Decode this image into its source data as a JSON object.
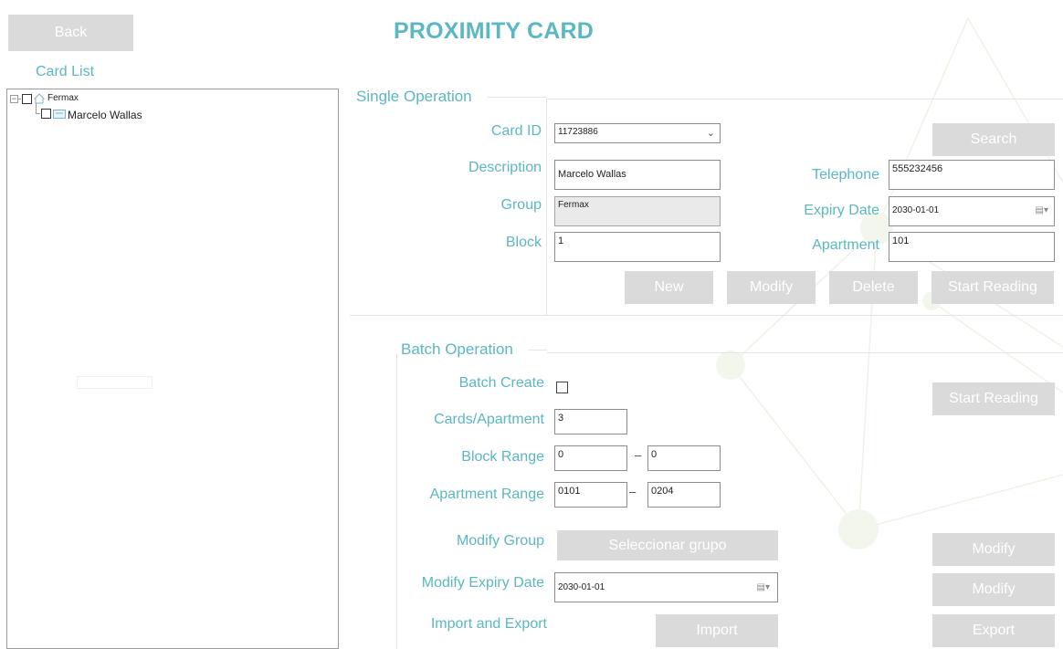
{
  "header": {
    "back_label": "Back",
    "title": "PROXIMITY CARD"
  },
  "card_list": {
    "heading": "Card List",
    "tree": [
      {
        "label": "Fermax"
      },
      {
        "label": "Marcelo Wallas"
      }
    ]
  },
  "single": {
    "legend": "Single Operation",
    "card_id_label": "Card ID",
    "card_id_value": "11723886",
    "search_label": "Search",
    "description_label": "Description",
    "description_value": "Marcelo Wallas",
    "telephone_label": "Telephone",
    "telephone_value": "555232456",
    "group_label": "Group",
    "group_value": "Fermax",
    "expiry_label": "Expiry Date",
    "expiry_value": "2030-01-01",
    "block_label": "Block",
    "block_value": "1",
    "apartment_label": "Apartment",
    "apartment_value": "101",
    "new_label": "New",
    "modify_label": "Modify",
    "delete_label": "Delete",
    "start_reading_label": "Start Reading"
  },
  "batch": {
    "legend": "Batch Operation",
    "batch_create_label": "Batch Create",
    "start_reading_label": "Start Reading",
    "cards_per_apartment_label": "Cards/Apartment",
    "cards_per_apartment_value": "3",
    "block_range_label": "Block Range",
    "block_range_from": "0",
    "block_range_to": "0",
    "apartment_range_label": "Apartment Range",
    "apartment_range_from": "0101",
    "apartment_range_to": "0204",
    "range_separator": "–",
    "modify_group_label": "Modify Group",
    "select_group_label": "Seleccionar grupo",
    "modify_group_btn": "Modify",
    "modify_expiry_label": "Modify Expiry Date",
    "modify_expiry_value": "2030-01-01",
    "modify_expiry_btn": "Modify",
    "import_export_label": "Import and Export",
    "import_label": "Import",
    "export_label": "Export"
  },
  "colors": {
    "accent": "#5bb7c2",
    "button_bg": "#dadada",
    "button_text": "#ffffff"
  }
}
